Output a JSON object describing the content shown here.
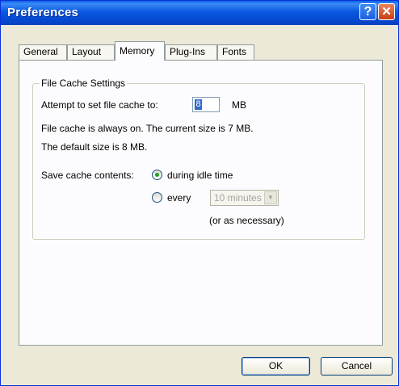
{
  "window": {
    "title": "Preferences",
    "help_glyph": "?",
    "close_glyph": "✕"
  },
  "tabs": [
    {
      "label": "General",
      "active": false
    },
    {
      "label": "Layout",
      "active": false
    },
    {
      "label": "Memory",
      "active": true
    },
    {
      "label": "Plug-Ins",
      "active": false
    },
    {
      "label": "Fonts",
      "active": false
    }
  ],
  "cache": {
    "group_title": "File Cache Settings",
    "attempt_label": "Attempt to set file cache to:",
    "size_value": "8",
    "size_unit": "MB",
    "always_on_text": "File cache is always on.  The current size is 7 MB.",
    "default_text": "The default size is 8 MB.",
    "save_label": "Save cache contents:",
    "option_idle": "during idle time",
    "option_every": "every",
    "interval_value": "10 minutes",
    "as_necessary": "(or as necessary)"
  },
  "buttons": {
    "ok": "OK",
    "cancel": "Cancel"
  },
  "colors": {
    "titlebar": "#0a58e0",
    "face": "#ece9d8",
    "panel": "#fcfcfe",
    "selection": "#316ac5",
    "radio_dot": "#21a121"
  },
  "icons": {
    "help": "help-icon",
    "close": "close-icon",
    "dropdown": "chevron-down-icon"
  }
}
